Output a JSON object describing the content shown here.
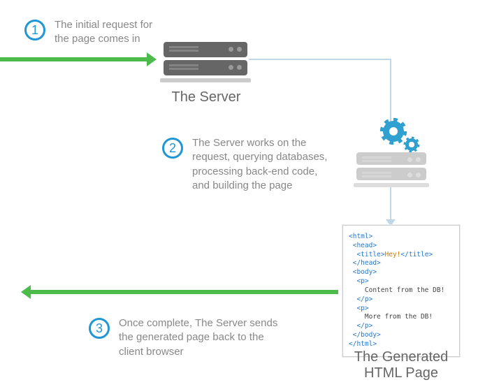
{
  "steps": [
    {
      "num": "1",
      "text": "The initial request for\nthe page comes in"
    },
    {
      "num": "2",
      "text": "The Server works on the\nrequest, querying databases,\nprocessing back-end code,\nand building the page"
    },
    {
      "num": "3",
      "text": "Once complete, The Server sends\nthe generated page back to the\nclient browser"
    }
  ],
  "captions": {
    "server": "The Server",
    "generated": "The Generated\nHTML Page"
  },
  "html_page": {
    "title_text": "Hey!",
    "p1": "Content from the DB!",
    "p2": "More from the DB!"
  }
}
